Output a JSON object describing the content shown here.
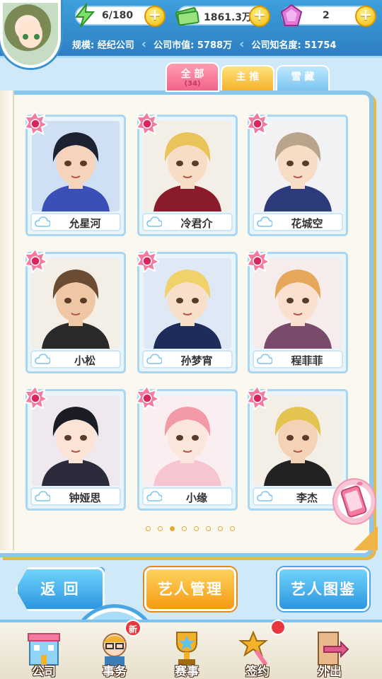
{
  "resources": {
    "energy": "6/180",
    "money": "1861.3万",
    "gems": "2"
  },
  "info": {
    "scale": "规模: 经纪公司",
    "market_value": "公司市值: 5788万",
    "fame": "公司知名度: 51754"
  },
  "tabs": {
    "all_label": "全 部",
    "all_count": "(34)",
    "main_label": "主 推",
    "fav_label": "雪 藏"
  },
  "artists": [
    {
      "name": "允星河",
      "hair": "#1d2233",
      "skin": "#f6d4bc",
      "outfit": "#3a4fb8",
      "bg": "#cfe0f5"
    },
    {
      "name": "冷君介",
      "hair": "#e8c45a",
      "skin": "#f7dcc6",
      "outfit": "#8a1b2a",
      "bg": "#f3efe6"
    },
    {
      "name": "花城空",
      "hair": "#b9a58c",
      "skin": "#f7dcc6",
      "outfit": "#2d3a7c",
      "bg": "#f2f2f5"
    },
    {
      "name": "小松",
      "hair": "#6b4b32",
      "skin": "#f0c7a4",
      "outfit": "#2a2a2a",
      "bg": "#f3efe6"
    },
    {
      "name": "孙梦宵",
      "hair": "#f1d16a",
      "skin": "#f8dfca",
      "outfit": "#1e2c5c",
      "bg": "#dfe9f5"
    },
    {
      "name": "程菲菲",
      "hair": "#e6a75a",
      "skin": "#f9e0cf",
      "outfit": "#7a4a6a",
      "bg": "#f6ecec"
    },
    {
      "name": "钟娅思",
      "hair": "#1b1c26",
      "skin": "#fbe4d6",
      "outfit": "#2b2b3b",
      "bg": "#efe8ee"
    },
    {
      "name": "小缘",
      "hair": "#f29aa6",
      "skin": "#fbe6dc",
      "outfit": "#f7c5cf",
      "bg": "#fbeef0"
    },
    {
      "name": "李杰",
      "hair": "#e4c450",
      "skin": "#f3d2b6",
      "outfit": "#222222",
      "bg": "#f3efe6"
    }
  ],
  "pagination": {
    "total": 8,
    "current": 3
  },
  "buttons": {
    "back": "返 回",
    "manage": "艺人管理",
    "dex": "艺人图鉴"
  },
  "nav": {
    "company": "公司",
    "affairs": "事务",
    "events": "赛事",
    "contract": "签约",
    "outing": "外出",
    "new_badge": "新",
    "active": "affairs"
  },
  "colors": {
    "accent_blue": "#3d9fdc",
    "accent_orange": "#f49a14",
    "accent_pink": "#f0648a"
  }
}
